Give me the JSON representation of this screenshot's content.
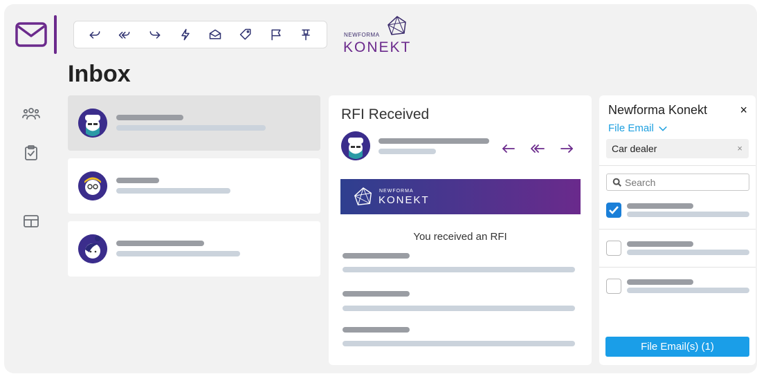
{
  "app": {
    "icon": "envelope-icon",
    "accent": "#6b2a8c"
  },
  "toolbar": {
    "buttons": [
      "reply-icon",
      "reply-all-icon",
      "forward-icon",
      "lightning-icon",
      "open-envelope-icon",
      "tag-icon",
      "flag-icon",
      "pin-icon"
    ]
  },
  "logo": {
    "small": "NEWFORMA",
    "big": "KONEKT"
  },
  "inbox": {
    "title": "Inbox"
  },
  "sidebar": {
    "icons": [
      "people-icon",
      "clipboard-check-icon",
      "table-icon"
    ]
  },
  "reader": {
    "title": "RFI Received",
    "actions": [
      "reply-icon",
      "reply-all-icon",
      "forward-icon"
    ],
    "banner": {
      "small": "NEWFORMA",
      "big": "KONEKT",
      "gradient": [
        "#2e3f8f",
        "#6a2a8c"
      ]
    },
    "message": "You received an RFI"
  },
  "pane": {
    "title": "Newforma Konekt",
    "close": "×",
    "file_label": "File Email",
    "chip": "Car dealer",
    "chip_close": "×",
    "search_placeholder": "Search",
    "items": [
      {
        "checked": true
      },
      {
        "checked": false
      },
      {
        "checked": false
      }
    ],
    "file_button": "File Email(s) (1)",
    "button_color": "#1a9ee8"
  }
}
